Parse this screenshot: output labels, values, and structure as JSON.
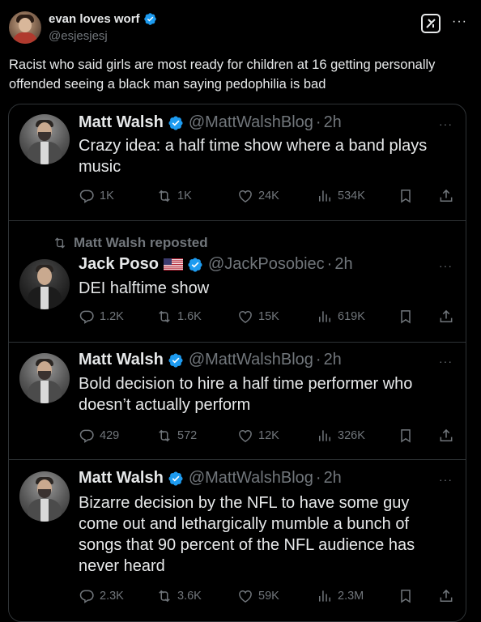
{
  "outer_post": {
    "author_name": "evan loves worf",
    "author_handle": "@esjesjesj",
    "text": "Racist who said girls are most ready for children at 16 getting personally offended seeing a black man saying pedophilia is bad",
    "more_label": "···",
    "grok_icon": "grok-icon"
  },
  "quoted_tweets": [
    {
      "repost_label": "",
      "name": "Matt Walsh",
      "handle": "@MattWalshBlog",
      "separator": "·",
      "time": "2h",
      "text": "Crazy idea: a half time show where a band plays music",
      "replies": "1K",
      "reposts": "1K",
      "likes": "24K",
      "views": "534K"
    },
    {
      "repost_label": "Matt Walsh reposted",
      "name": "Jack Poso",
      "flag": "us-flag",
      "handle": "@JackPosobiec",
      "separator": "·",
      "time": "2h",
      "text": "DEI halftime show",
      "replies": "1.2K",
      "reposts": "1.6K",
      "likes": "15K",
      "views": "619K"
    },
    {
      "repost_label": "",
      "name": "Matt Walsh",
      "handle": "@MattWalshBlog",
      "separator": "·",
      "time": "2h",
      "text": "Bold decision to hire a half time performer who doesn’t actually perform",
      "replies": "429",
      "reposts": "572",
      "likes": "12K",
      "views": "326K"
    },
    {
      "repost_label": "",
      "name": "Matt Walsh",
      "handle": "@MattWalshBlog",
      "separator": "·",
      "time": "2h",
      "text": "Bizarre decision by the NFL to have some guy come out and lethargically mumble a bunch of songs that 90 percent of the NFL audience has never heard",
      "replies": "2.3K",
      "reposts": "3.6K",
      "likes": "59K",
      "views": "2.3M"
    }
  ],
  "tweet_more_label": "···",
  "colors": {
    "background": "#000000",
    "text": "#e7e9ea",
    "muted": "#71767b",
    "border": "#2f3336",
    "verified": "#1d9bf0"
  },
  "icons": [
    "verified-badge-icon",
    "reply-icon",
    "repost-icon",
    "like-icon",
    "views-icon",
    "bookmark-icon",
    "share-icon",
    "more-icon"
  ]
}
